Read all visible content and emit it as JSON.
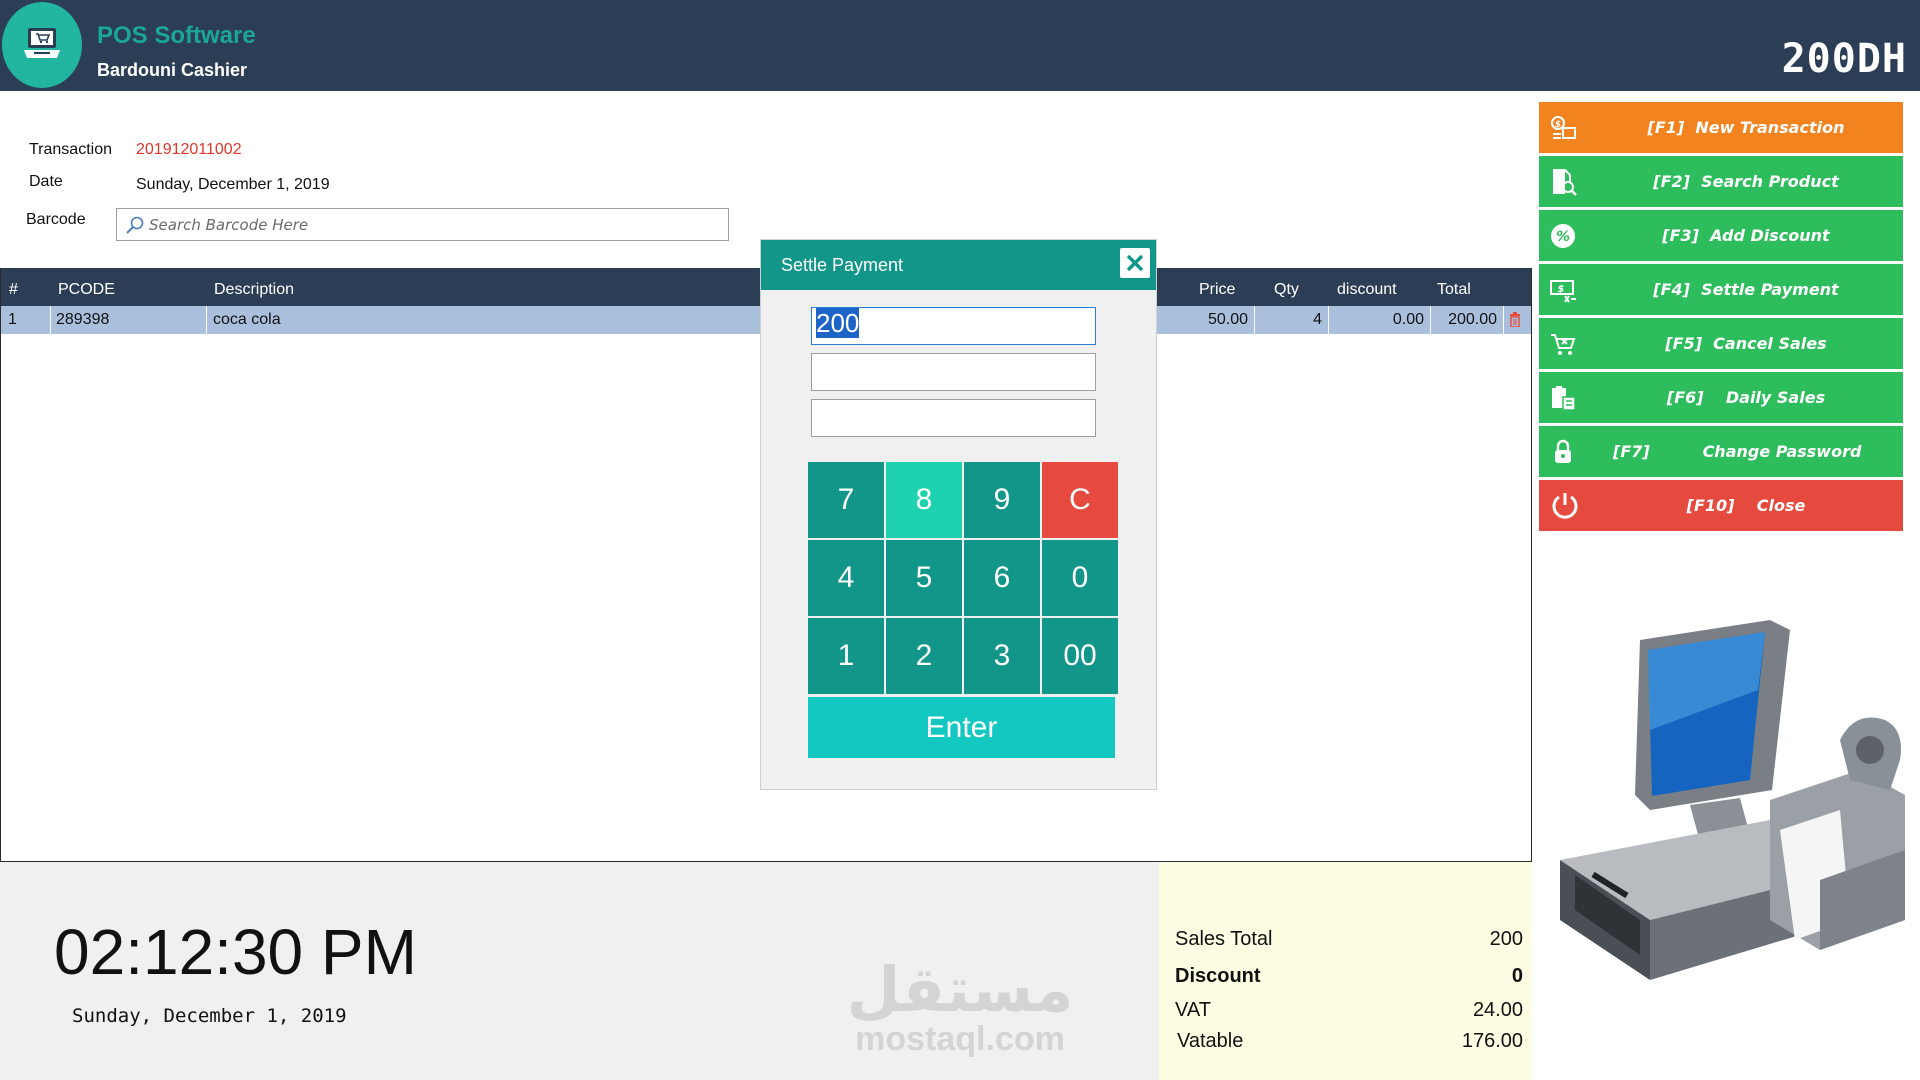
{
  "header": {
    "app_title": "POS Software",
    "cashier": "Bardouni Cashier",
    "total_display": "200DH",
    "logo_icon": "cash-register-laptop-icon"
  },
  "form": {
    "transaction_label": "Transaction",
    "transaction_value": "201912011002",
    "date_label": "Date",
    "date_value": "Sunday, December 1, 2019",
    "barcode_label": "Barcode",
    "barcode_placeholder": "Search Barcode Here"
  },
  "grid": {
    "columns": [
      "#",
      "PCODE",
      "Description",
      "Price",
      "Qty",
      "discount",
      "Total"
    ],
    "rows": [
      {
        "num": "1",
        "pcode": "289398",
        "description": "coca cola",
        "price": "50.00",
        "qty": "4",
        "discount": "0.00",
        "total": "200.00"
      }
    ]
  },
  "modal": {
    "title": "Settle Payment",
    "amount_value": "200",
    "field2_value": "",
    "field3_value": "",
    "keys": [
      "7",
      "8",
      "9",
      "C",
      "4",
      "5",
      "6",
      "0",
      "1",
      "2",
      "3",
      "00"
    ],
    "enter_label": "Enter"
  },
  "clock": {
    "time": "02:12:30 PM",
    "date": "Sunday, December 1, 2019"
  },
  "watermark": {
    "arabic": "مستقل",
    "latin": "mostaql.com"
  },
  "summary": {
    "sales_total_label": "Sales Total",
    "sales_total_value": "200",
    "discount_label": "Discount",
    "discount_value": "0",
    "vat_label": "VAT",
    "vat_value": "24.00",
    "vatable_label": "Vatable",
    "vatable_value": "176.00"
  },
  "sidebar": {
    "buttons": [
      {
        "key": "[F1]",
        "label": "New Transaction",
        "icon": "new-transaction-icon",
        "color": "#f2831e"
      },
      {
        "key": "[F2]",
        "label": "Search Product",
        "icon": "search-product-icon",
        "color": "#2ebd5c"
      },
      {
        "key": "[F3]",
        "label": "Add Discount",
        "icon": "discount-icon",
        "color": "#2ebd5c"
      },
      {
        "key": "[F4]",
        "label": "Settle Payment",
        "icon": "settle-payment-icon",
        "color": "#2ebd5c"
      },
      {
        "key": "[F5]",
        "label": "Cancel Sales",
        "icon": "cancel-cart-icon",
        "color": "#2ebd5c"
      },
      {
        "key": "[F6]",
        "label": "Daily Sales",
        "icon": "daily-sales-icon",
        "color": "#2ebd5c"
      },
      {
        "key": "[F7]",
        "label": "Change Password",
        "icon": "lock-icon",
        "color": "#2ebd5c"
      },
      {
        "key": "[F10]",
        "label": "Close",
        "icon": "power-icon",
        "color": "#e64a3e"
      }
    ]
  },
  "colors": {
    "header_bg": "#2c3e55",
    "teal": "#12968a",
    "accent_green": "#2ebd5c",
    "accent_orange": "#f2831e",
    "accent_red": "#e64a3e",
    "selected_row": "#a9bfdb",
    "summary_bg": "#fdfde3"
  }
}
